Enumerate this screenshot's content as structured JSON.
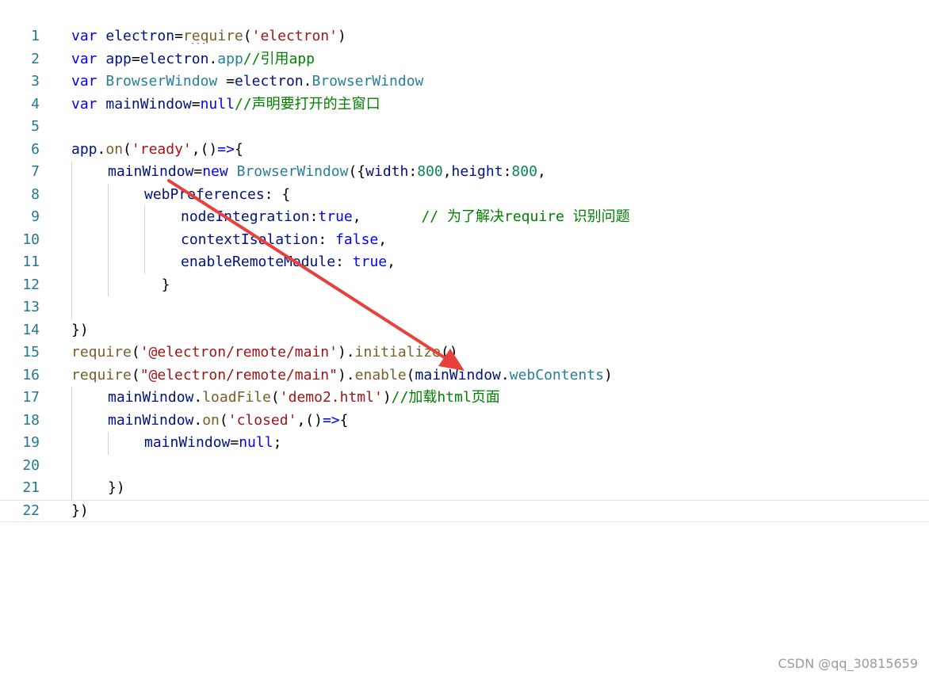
{
  "colors": {
    "keyword": "#0000ff",
    "variable": "#001080",
    "class": "#267f99",
    "function": "#795e26",
    "string": "#a31515",
    "number": "#098658",
    "comment": "#008000",
    "line_number": "#237893",
    "annotation_arrow": "#e8403a"
  },
  "lines": [
    {
      "n": "1",
      "indent": 0,
      "tokens": [
        [
          "kw",
          "var "
        ],
        [
          "var",
          "electron"
        ],
        [
          "op",
          "="
        ],
        [
          "fn",
          "require"
        ],
        [
          "op",
          "("
        ],
        [
          "str",
          "'electron'"
        ],
        [
          "op",
          ")"
        ]
      ]
    },
    {
      "n": "2",
      "indent": 0,
      "tokens": [
        [
          "kw",
          "var "
        ],
        [
          "var",
          "app"
        ],
        [
          "op",
          "="
        ],
        [
          "var",
          "electron"
        ],
        [
          "op",
          "."
        ],
        [
          "cls",
          "app"
        ],
        [
          "com",
          "//引用"
        ],
        [
          "com",
          "app"
        ]
      ]
    },
    {
      "n": "3",
      "indent": 0,
      "tokens": [
        [
          "kw",
          "var "
        ],
        [
          "cls",
          "BrowserWindow"
        ],
        [
          "op",
          " ="
        ],
        [
          "var",
          "electron"
        ],
        [
          "op",
          "."
        ],
        [
          "cls",
          "BrowserWindow"
        ]
      ]
    },
    {
      "n": "4",
      "indent": 0,
      "tokens": [
        [
          "kw",
          "var "
        ],
        [
          "var",
          "mainWindow"
        ],
        [
          "op",
          "="
        ],
        [
          "kw",
          "null"
        ],
        [
          "com",
          "//声明要打开的主窗口"
        ]
      ]
    },
    {
      "n": "5",
      "indent": 0,
      "tokens": []
    },
    {
      "n": "6",
      "indent": 0,
      "tokens": [
        [
          "var",
          "app"
        ],
        [
          "op",
          "."
        ],
        [
          "fn",
          "on"
        ],
        [
          "op",
          "("
        ],
        [
          "str",
          "'ready'"
        ],
        [
          "op",
          ",()"
        ],
        [
          "kw",
          "=>"
        ],
        [
          "op",
          "{"
        ]
      ]
    },
    {
      "n": "7",
      "indent": 1,
      "tokens": [
        [
          "var",
          "mainWindow"
        ],
        [
          "op",
          "="
        ],
        [
          "kw",
          "new "
        ],
        [
          "cls",
          "BrowserWindow"
        ],
        [
          "op",
          "({"
        ],
        [
          "var",
          "width"
        ],
        [
          "op",
          ":"
        ],
        [
          "num",
          "800"
        ],
        [
          "op",
          ","
        ],
        [
          "var",
          "height"
        ],
        [
          "op",
          ":"
        ],
        [
          "num",
          "800"
        ],
        [
          "op",
          ","
        ]
      ]
    },
    {
      "n": "8",
      "indent": 2,
      "tokens": [
        [
          "var",
          "webPreferences"
        ],
        [
          "op",
          ": {"
        ]
      ]
    },
    {
      "n": "9",
      "indent": 3,
      "tokens": [
        [
          "var",
          "nodeIntegration"
        ],
        [
          "op",
          ":"
        ],
        [
          "kw",
          "true"
        ],
        [
          "op",
          ",       "
        ],
        [
          "com",
          "// 为了解决"
        ],
        [
          "com",
          "require"
        ],
        [
          "com",
          " 识别问题"
        ]
      ]
    },
    {
      "n": "10",
      "indent": 3,
      "tokens": [
        [
          "var",
          "contextIsolation"
        ],
        [
          "op",
          ": "
        ],
        [
          "kw",
          "false"
        ],
        [
          "op",
          ","
        ]
      ]
    },
    {
      "n": "11",
      "indent": 3,
      "tokens": [
        [
          "var",
          "enableRemoteModule"
        ],
        [
          "op",
          ": "
        ],
        [
          "kw",
          "true"
        ],
        [
          "op",
          ","
        ]
      ]
    },
    {
      "n": "12",
      "indent": 2,
      "tokens": [
        [
          "op",
          "  }"
        ]
      ]
    },
    {
      "n": "13",
      "indent": 1,
      "tokens": []
    },
    {
      "n": "14",
      "indent": 0,
      "tokens": [
        [
          "op",
          "})"
        ]
      ]
    },
    {
      "n": "15",
      "indent": 0,
      "tokens": [
        [
          "fn",
          "require"
        ],
        [
          "op",
          "("
        ],
        [
          "str",
          "'@electron/remote/main'"
        ],
        [
          "op",
          ")."
        ],
        [
          "fn",
          "initialize"
        ],
        [
          "op",
          "()"
        ]
      ]
    },
    {
      "n": "16",
      "indent": 0,
      "tokens": [
        [
          "fn",
          "require"
        ],
        [
          "op",
          "("
        ],
        [
          "str",
          "\"@electron/remote/main\""
        ],
        [
          "op",
          ")."
        ],
        [
          "fn",
          "enable"
        ],
        [
          "op",
          "("
        ],
        [
          "var",
          "mainWindow"
        ],
        [
          "op",
          "."
        ],
        [
          "cls",
          "webContents"
        ],
        [
          "op",
          ")"
        ]
      ]
    },
    {
      "n": "17",
      "indent": 1,
      "tokens": [
        [
          "var",
          "mainWindow"
        ],
        [
          "op",
          "."
        ],
        [
          "fn",
          "loadFile"
        ],
        [
          "op",
          "("
        ],
        [
          "str",
          "'demo2.html'"
        ],
        [
          "op",
          ")"
        ],
        [
          "com",
          "//加载"
        ],
        [
          "com",
          "html"
        ],
        [
          "com",
          "页面"
        ]
      ]
    },
    {
      "n": "18",
      "indent": 1,
      "tokens": [
        [
          "var",
          "mainWindow"
        ],
        [
          "op",
          "."
        ],
        [
          "fn",
          "on"
        ],
        [
          "op",
          "("
        ],
        [
          "str",
          "'closed'"
        ],
        [
          "op",
          ",()"
        ],
        [
          "kw",
          "=>"
        ],
        [
          "op",
          "{"
        ]
      ]
    },
    {
      "n": "19",
      "indent": 2,
      "tokens": [
        [
          "var",
          "mainWindow"
        ],
        [
          "op",
          "="
        ],
        [
          "kw",
          "null"
        ],
        [
          "op",
          ";"
        ]
      ]
    },
    {
      "n": "20",
      "indent": 1,
      "tokens": []
    },
    {
      "n": "21",
      "indent": 1,
      "tokens": [
        [
          "op",
          "})"
        ]
      ]
    },
    {
      "n": "22",
      "indent": 0,
      "tokens": [
        [
          "op",
          "})"
        ]
      ]
    }
  ],
  "current_line": "22",
  "watermark": "CSDN @qq_30815659"
}
